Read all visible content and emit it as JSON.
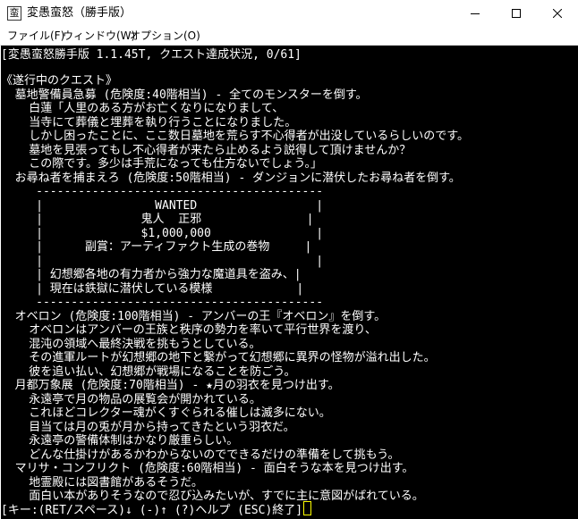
{
  "window": {
    "title": "変愚蛮怒（勝手版）",
    "icon": "app-icon",
    "icon_glyph": "蛮",
    "controls": [
      "minimize-icon",
      "maximize-icon",
      "close-icon"
    ]
  },
  "menu": {
    "items": [
      "ファイル(F)",
      "ウィンドウ(W)",
      "オプション(O)"
    ]
  },
  "console": {
    "header": "[変愚蛮怒勝手版 1.1.45T, クエスト達成状況, 0/61]",
    "lines": [
      "《遂行中のクエスト》",
      "  墓地警備員急募 (危険度:40階相当) - 全てのモンスターを倒す。",
      "    白蓮「人里のある方がお亡くなりになりまして、",
      "    当寺にて葬儀と埋葬を執り行うことになりました。",
      "    しかし困ったことに、ここ数日墓地を荒らす不心得者が出没しているらしいのです。",
      "    墓地を見張ってもし不心得者が来たら止めるよう説得して頂けませんか？",
      "    この際です。多少は手荒になっても仕方ないでしょう。」",
      "  お尋ね者を捕まえろ (危険度:50階相当) - ダンジョンに潜伏したお尋ね者を倒す。",
      "     -----------------------------------------",
      "     |                WANTED                 |",
      "     |              鬼人  正邪               |",
      "     |              $1,000,000               |",
      "     |      副賞：アーティファクト生成の巻物     |",
      "     |                                       |",
      "     | 幻想郷各地の有力者から強力な魔道具を盗み、|",
      "     | 現在は鉄獄に潜伏している模様            |",
      "     -----------------------------------------",
      "  オベロン (危険度:100階相当) - アンバーの王『オベロン』を倒す。",
      "    オベロンはアンバーの王族と秩序の勢力を率いて平行世界を渡り、",
      "    混沌の領域へ最終決戦を挑もうとしている。",
      "    その進軍ルートが幻想郷の地下と繋がって幻想郷に異界の怪物が溢れ出した。",
      "    彼を追い払い、幻想郷が戦場になることを防ごう。",
      "  月都万象展 (危険度:70階相当) - ★月の羽衣を見つけ出す。",
      "    永遠亭で月の物品の展覧会が開かれている。",
      "    これほどコレクター魂がくすぐられる催しは滅多にない。",
      "    目当ては月の兎が月から持ってきたという羽衣だ。",
      "    永遠亭の警備体制はかなり厳重らしい。",
      "    どんな仕掛けがあるかわからないのでできるだけの準備をして挑もう。",
      "  マリサ・コンフリクト (危険度:60階相当) - 面白そうな本を見つけ出す。",
      "    地霊殿には図書館があるそうだ。",
      "    面白い本がありそうなので忍び込みたいが、すでに主に意図がばれている。"
    ],
    "prompt": "[キー:(RET/スペース)↓ (-)↑ (?)ヘルプ (ESC)終了]",
    "cursor_color": "#ffff00"
  }
}
